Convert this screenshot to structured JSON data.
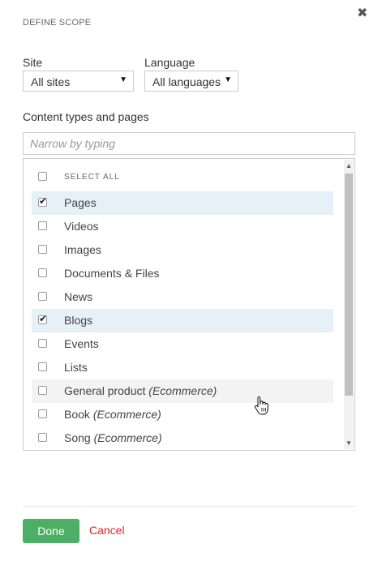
{
  "dialog": {
    "title": "DEFINE SCOPE",
    "close_glyph": "✖"
  },
  "filters": {
    "site_label": "Site",
    "site_value": "All sites",
    "language_label": "Language",
    "language_value": "All languages",
    "caret": "▼"
  },
  "content": {
    "title": "Content types and pages",
    "search_placeholder": "Narrow by typing",
    "items": [
      {
        "label": "SELECT ALL",
        "suffix": "",
        "checked": false
      },
      {
        "label": "Pages",
        "suffix": "",
        "checked": true
      },
      {
        "label": "Videos",
        "suffix": "",
        "checked": false
      },
      {
        "label": "Images",
        "suffix": "",
        "checked": false
      },
      {
        "label": "Documents & Files",
        "suffix": "",
        "checked": false
      },
      {
        "label": "News",
        "suffix": "",
        "checked": false
      },
      {
        "label": "Blogs",
        "suffix": "",
        "checked": true
      },
      {
        "label": "Events",
        "suffix": "",
        "checked": false
      },
      {
        "label": "Lists",
        "suffix": "",
        "checked": false
      },
      {
        "label": "General product",
        "suffix": "(Ecommerce)",
        "checked": false
      },
      {
        "label": "Book",
        "suffix": "(Ecommerce)",
        "checked": false
      },
      {
        "label": "Song",
        "suffix": "(Ecommerce)",
        "checked": false
      }
    ]
  },
  "footer": {
    "done_label": "Done",
    "cancel_label": "Cancel"
  },
  "colors": {
    "done": "#4caf65",
    "cancel": "#e0221f",
    "checked_row": "#e6f0f7"
  },
  "icons": {
    "close": "close-icon",
    "cursor": "hand-pointer-icon"
  }
}
